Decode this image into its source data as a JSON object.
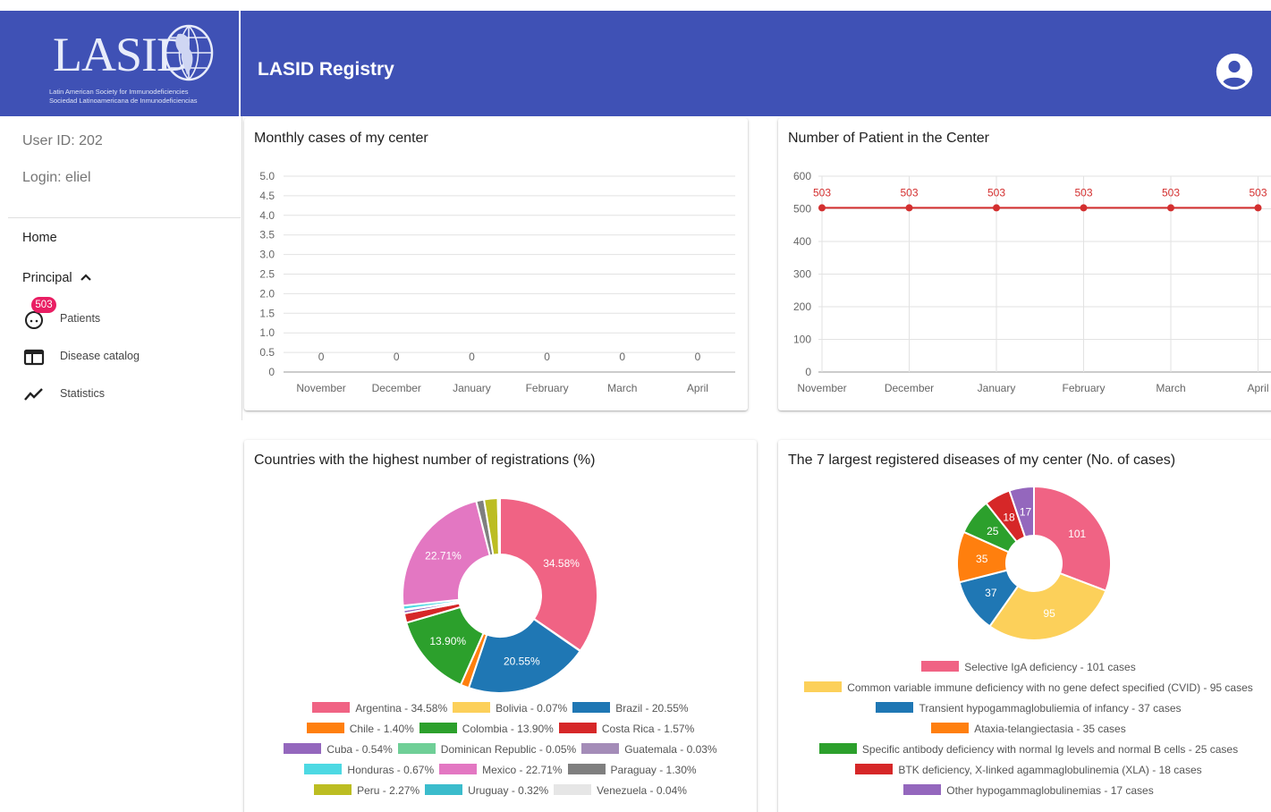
{
  "header": {
    "logo_text": "LASID",
    "logo_sub1": "Latin American Society for Immunodeficiencies",
    "logo_sub2": "Sociedad Latinoamericana de Inmunodeficiencias",
    "title": "LASID Registry",
    "account_icon": "account-circle-icon"
  },
  "sidebar": {
    "user_id": "User ID: 202",
    "login": "Login: eliel",
    "home": "Home",
    "principal": "Principal",
    "items": [
      {
        "label": "Patients",
        "icon": "face-icon",
        "badge": "503"
      },
      {
        "label": "Disease catalog",
        "icon": "catalog-icon"
      },
      {
        "label": "Statistics",
        "icon": "trending-icon"
      }
    ]
  },
  "cards": {
    "monthly_title": "Monthly cases of my center",
    "patients_title": "Number of Patient in the Center",
    "countries_title": "Countries with the highest number of registrations (%)",
    "diseases_title": "The 7 largest registered diseases of my center (No. of cases)"
  },
  "chart_data": [
    {
      "type": "bar",
      "title": "Monthly cases of my center",
      "categories": [
        "November",
        "December",
        "January",
        "February",
        "March",
        "April"
      ],
      "values": [
        0,
        0,
        0,
        0,
        0,
        0
      ],
      "yticks": [
        "0",
        "0.5",
        "1.0",
        "1.5",
        "2.0",
        "2.5",
        "3.0",
        "3.5",
        "4.0",
        "4.5",
        "5.0"
      ],
      "ylim": [
        0,
        5
      ],
      "grid": true
    },
    {
      "type": "line",
      "title": "Number of Patient in the Center",
      "categories": [
        "November",
        "December",
        "January",
        "February",
        "March",
        "April"
      ],
      "values": [
        503,
        503,
        503,
        503,
        503,
        503
      ],
      "yticks": [
        "0",
        "100",
        "200",
        "300",
        "400",
        "500",
        "600"
      ],
      "ylim": [
        0,
        600
      ],
      "color": "#d32f2f",
      "grid": true
    },
    {
      "type": "pie",
      "title": "Countries with the highest number of registrations (%)",
      "slices": [
        {
          "label": "Argentina - 34.58%",
          "value": 34.58,
          "text": "34.58%",
          "color": "#f06384"
        },
        {
          "label": "Bolivia - 0.07%",
          "value": 0.07,
          "text": "",
          "color": "#fcd05a"
        },
        {
          "label": "Brazil - 20.55%",
          "value": 20.55,
          "text": "20.55%",
          "color": "#1f77b4"
        },
        {
          "label": "Chile - 1.40%",
          "value": 1.4,
          "text": "",
          "color": "#ff7f0e"
        },
        {
          "label": "Colombia - 13.90%",
          "value": 13.9,
          "text": "13.90%",
          "color": "#2ca02c"
        },
        {
          "label": "Costa Rica - 1.57%",
          "value": 1.57,
          "text": "",
          "color": "#d62728"
        },
        {
          "label": "Cuba - 0.54%",
          "value": 0.54,
          "text": "",
          "color": "#9467bd"
        },
        {
          "label": "Dominican Republic - 0.05%",
          "value": 0.05,
          "text": "",
          "color": "#6fcf97"
        },
        {
          "label": "Guatemala - 0.03%",
          "value": 0.03,
          "text": "",
          "color": "#a48cb8"
        },
        {
          "label": "Honduras - 0.67%",
          "value": 0.67,
          "text": "",
          "color": "#4dd9e3"
        },
        {
          "label": "Mexico - 22.71%",
          "value": 22.71,
          "text": "22.71%",
          "color": "#e377c2"
        },
        {
          "label": "Paraguay - 1.30%",
          "value": 1.3,
          "text": "",
          "color": "#7f7f7f"
        },
        {
          "label": "Peru - 2.27%",
          "value": 2.27,
          "text": "",
          "color": "#bcbd22"
        },
        {
          "label": "Uruguay - 0.32%",
          "value": 0.32,
          "text": "",
          "color": "#3bbccc"
        },
        {
          "label": "Venezuela - 0.04%",
          "value": 0.04,
          "text": "",
          "color": "#e6e6e6"
        }
      ],
      "legend": "bottom",
      "legend_rows": [
        [
          0,
          1,
          2
        ],
        [
          3,
          4,
          5
        ],
        [
          6,
          7,
          8
        ],
        [
          9,
          10,
          11
        ],
        [
          12,
          13,
          14
        ]
      ]
    },
    {
      "type": "pie",
      "title": "The 7 largest registered diseases of my center (No. of cases)",
      "slices": [
        {
          "label": "Selective IgA deficiency - 101 cases",
          "value": 101,
          "text": "101",
          "color": "#f06384"
        },
        {
          "label": "Common variable immune deficiency with no gene defect specified (CVID) - 95 cases",
          "value": 95,
          "text": "95",
          "color": "#fcd05a"
        },
        {
          "label": "Transient hypogammaglobuliemia of infancy - 37 cases",
          "value": 37,
          "text": "37",
          "color": "#1f77b4"
        },
        {
          "label": "Ataxia-telangiectasia - 35 cases",
          "value": 35,
          "text": "35",
          "color": "#ff7f0e"
        },
        {
          "label": "Specific antibody deficiency with normal Ig levels and normal B cells - 25 cases",
          "value": 25,
          "text": "25",
          "color": "#2ca02c"
        },
        {
          "label": "BTK deficiency, X-linked agammaglobulinemia (XLA) - 18 cases",
          "value": 18,
          "text": "18",
          "color": "#d62728"
        },
        {
          "label": "Other hypogammaglobulinemias - 17 cases",
          "value": 17,
          "text": "17",
          "color": "#9467bd"
        }
      ],
      "legend": "bottom",
      "legend_rows": [
        [
          0
        ],
        [
          1
        ],
        [
          2
        ],
        [
          3
        ],
        [
          4
        ],
        [
          5
        ],
        [
          6
        ]
      ]
    }
  ]
}
